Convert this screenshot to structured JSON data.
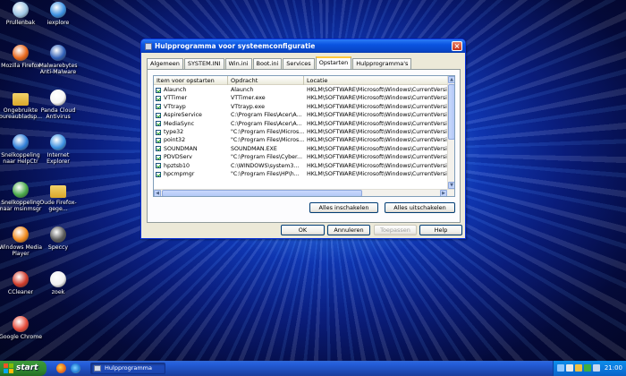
{
  "desktop": {
    "icons": [
      {
        "label": "Prullenbak",
        "icon": "recycle-bin"
      },
      {
        "label": "iexplore",
        "icon": "internet-explorer"
      },
      {
        "label": "Mozilla Firefox",
        "icon": "firefox"
      },
      {
        "label": "Malwarebytes Anti-Malware",
        "icon": "malwarebytes"
      },
      {
        "label": "Ongebruikte bureaubladsp...",
        "icon": "folder"
      },
      {
        "label": "Panda Cloud Antivirus",
        "icon": "panda"
      },
      {
        "label": "Snelkoppeling naar HelpCtr",
        "icon": "help"
      },
      {
        "label": "Internet Explorer",
        "icon": "internet-explorer"
      },
      {
        "label": "Snelkoppeling naar msinmsgr",
        "icon": "msn-messenger"
      },
      {
        "label": "Oude Firefox-gege...",
        "icon": "folder"
      },
      {
        "label": "Windows Media Player",
        "icon": "media-player"
      },
      {
        "label": "Speccy",
        "icon": "speccy"
      },
      {
        "label": "CCleaner",
        "icon": "ccleaner"
      },
      {
        "label": "zoek",
        "icon": "search"
      },
      {
        "label": "Google Chrome",
        "icon": "chrome"
      }
    ]
  },
  "window": {
    "title": "Hulpprogramma voor systeemconfiguratie",
    "close_label": "×",
    "tabs": [
      "Algemeen",
      "SYSTEM.INI",
      "Win.ini",
      "Boot.ini",
      "Services",
      "Opstarten",
      "Hulpprogramma's"
    ],
    "active_tab": "Opstarten",
    "columns": [
      "Item voor opstarten",
      "Opdracht",
      "Locatie"
    ],
    "rows": [
      {
        "item": "Alaunch",
        "command": "Alaunch",
        "location": "HKLM\\SOFTWARE\\Microsoft\\Windows\\CurrentVersi...",
        "checked": true
      },
      {
        "item": "VTTimer",
        "command": "VTTimer.exe",
        "location": "HKLM\\SOFTWARE\\Microsoft\\Windows\\CurrentVersi...",
        "checked": true
      },
      {
        "item": "VTtrayp",
        "command": "VTtrayp.exe",
        "location": "HKLM\\SOFTWARE\\Microsoft\\Windows\\CurrentVersi...",
        "checked": true
      },
      {
        "item": "AspireService",
        "command": "C:\\Program Files\\Acer\\A...",
        "location": "HKLM\\SOFTWARE\\Microsoft\\Windows\\CurrentVersi...",
        "checked": true
      },
      {
        "item": "MediaSync",
        "command": "C:\\Program Files\\Acer\\A...",
        "location": "HKLM\\SOFTWARE\\Microsoft\\Windows\\CurrentVersi...",
        "checked": true
      },
      {
        "item": "type32",
        "command": "\"C:\\Program Files\\Micros...",
        "location": "HKLM\\SOFTWARE\\Microsoft\\Windows\\CurrentVersi...",
        "checked": true
      },
      {
        "item": "point32",
        "command": "\"C:\\Program Files\\Micros...",
        "location": "HKLM\\SOFTWARE\\Microsoft\\Windows\\CurrentVersi...",
        "checked": true
      },
      {
        "item": "SOUNDMAN",
        "command": "SOUNDMAN.EXE",
        "location": "HKLM\\SOFTWARE\\Microsoft\\Windows\\CurrentVersi...",
        "checked": true
      },
      {
        "item": "PDVDServ",
        "command": "\"C:\\Program Files\\Cyber...",
        "location": "HKLM\\SOFTWARE\\Microsoft\\Windows\\CurrentVersi...",
        "checked": true
      },
      {
        "item": "hpztsb10",
        "command": "C:\\WINDOWS\\system3...",
        "location": "HKLM\\SOFTWARE\\Microsoft\\Windows\\CurrentVersi...",
        "checked": true
      },
      {
        "item": "hpcmpmgr",
        "command": "\"C:\\Program Files\\HP\\h...",
        "location": "HKLM\\SOFTWARE\\Microsoft\\Windows\\CurrentVersi...",
        "checked": true
      }
    ],
    "buttons": {
      "enable_all": "Alles inschakelen",
      "disable_all": "Alles uitschakelen",
      "ok": "OK",
      "cancel": "Annuleren",
      "apply": "Toepassen",
      "help": "Help"
    }
  },
  "taskbar": {
    "start_label": "start",
    "task_label": "Hulpprogramma vo...",
    "clock": "21:00"
  },
  "colors": {
    "titlebar": "#0a53e0",
    "start": "#2f8a2f",
    "tray": "#0c7de0",
    "check": "#21a121"
  }
}
